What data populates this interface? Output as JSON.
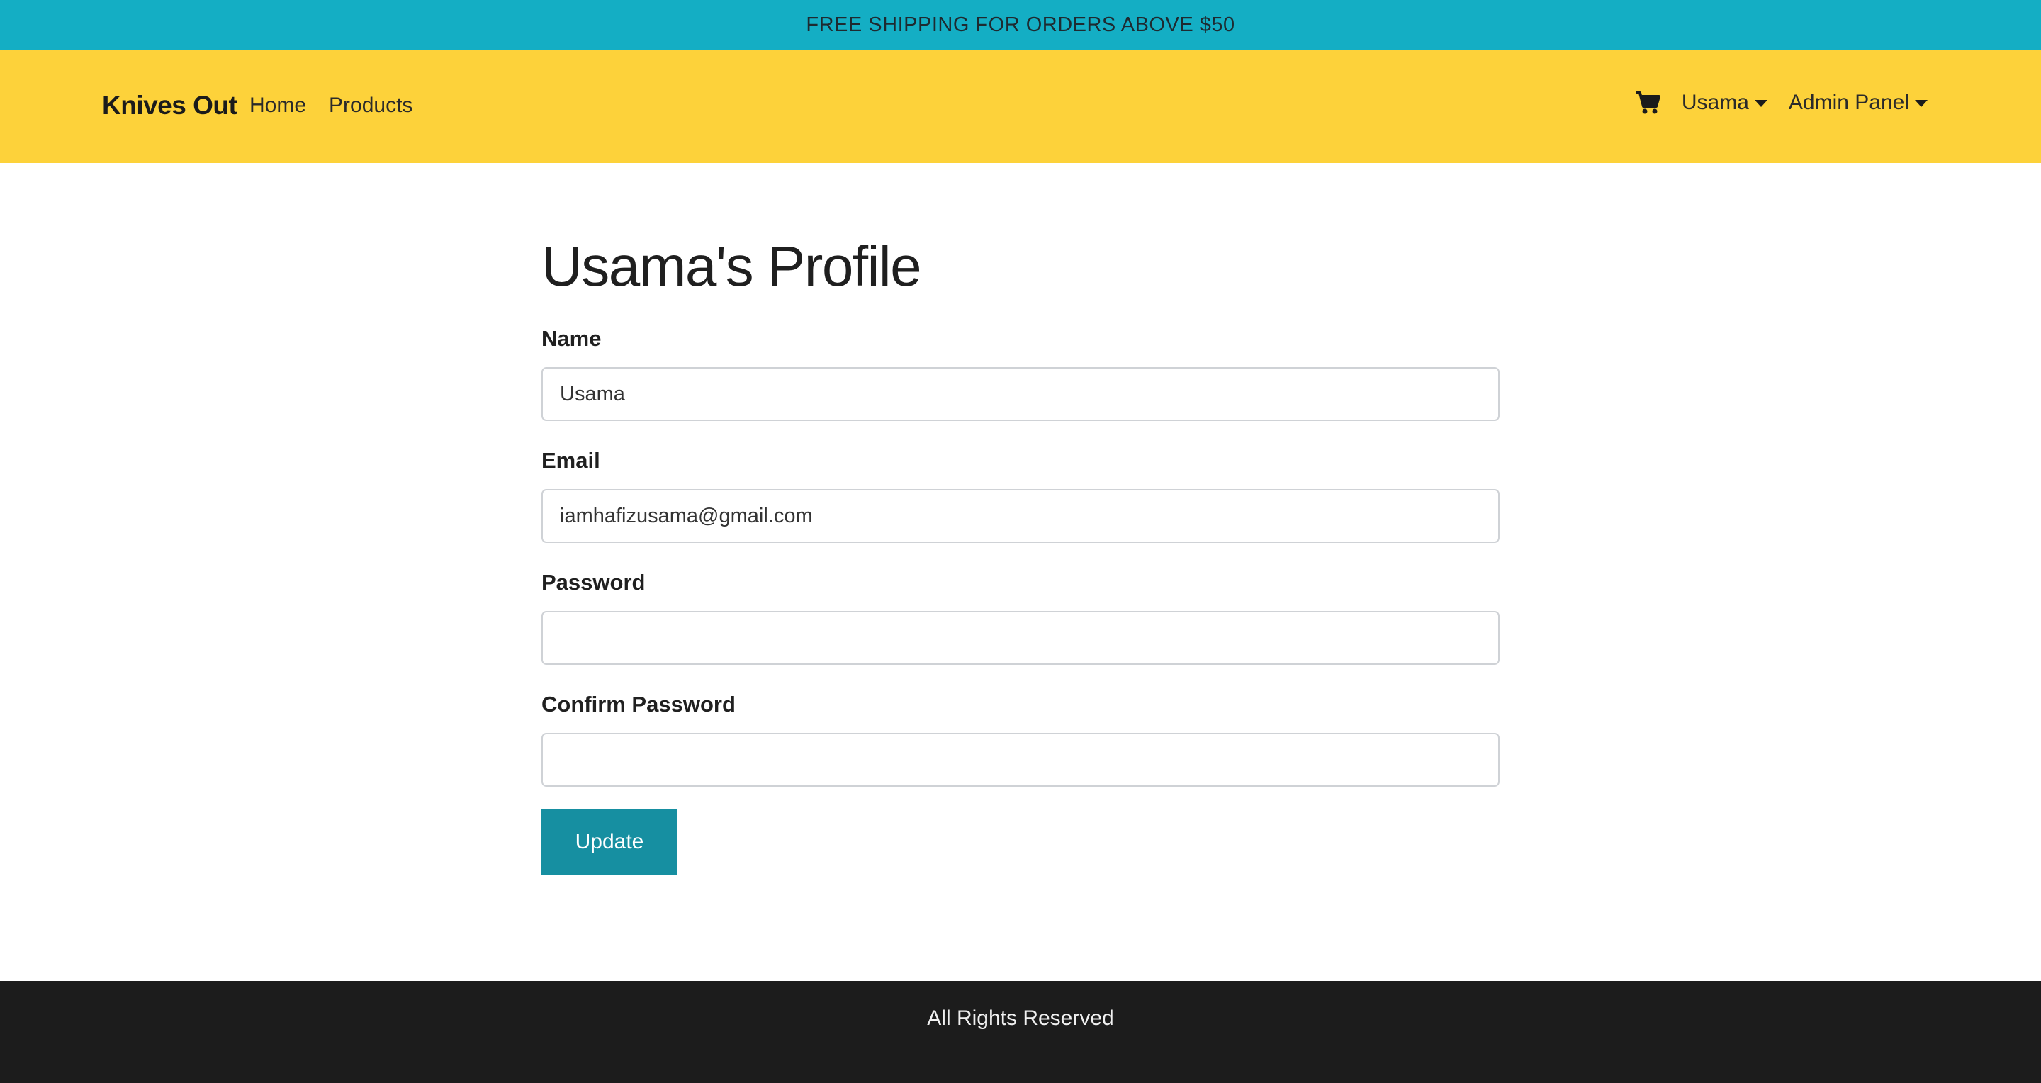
{
  "promo": {
    "text": "FREE SHIPPING FOR ORDERS ABOVE $50"
  },
  "navbar": {
    "brand": "Knives Out",
    "links": [
      "Home",
      "Products"
    ],
    "cart_icon": "shopping-cart-icon",
    "user_menu": "Usama",
    "admin_menu": "Admin Panel"
  },
  "profile": {
    "title": "Usama's Profile",
    "fields": {
      "name": {
        "label": "Name",
        "value": "Usama",
        "placeholder": ""
      },
      "email": {
        "label": "Email",
        "value": "iamhafizusama@gmail.com",
        "placeholder": ""
      },
      "password": {
        "label": "Password",
        "value": "",
        "placeholder": ""
      },
      "confirm_password": {
        "label": "Confirm Password",
        "value": "",
        "placeholder": ""
      }
    },
    "submit_label": "Update"
  },
  "footer": {
    "text": "All Rights Reserved"
  },
  "colors": {
    "promo_bg": "#14aec4",
    "navbar_bg": "#fdd23a",
    "button_bg": "#168fa1",
    "footer_bg": "#1c1c1c"
  }
}
